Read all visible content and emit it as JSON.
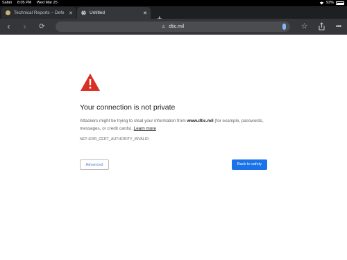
{
  "status_bar": {
    "app": "Safari",
    "time": "8:05 PM",
    "date": "Wed Mar 25",
    "battery": "93%"
  },
  "tabs": [
    {
      "title": "Technical Reports – Defe",
      "active": false,
      "icon": "site-favicon-icon"
    },
    {
      "title": "Untitled",
      "active": true,
      "icon": "globe-icon"
    }
  ],
  "toolbar": {
    "url": "dtic.mil"
  },
  "interstitial": {
    "heading": "Your connection is not private",
    "desc_part1": "Attackers might be trying to steal your information from ",
    "desc_domain": "www.dtic.mil",
    "desc_part2": " (for example, passwords, messages, or credit cards). ",
    "learn_more": "Learn more",
    "error_code": "NET::ERR_CERT_AUTHORITY_INVALID",
    "advanced_label": "Advanced",
    "back_label": "Back to safety"
  },
  "colors": {
    "warning_red": "#d93025",
    "primary_blue": "#1a73e8",
    "toolbar_bg": "#35363a"
  }
}
